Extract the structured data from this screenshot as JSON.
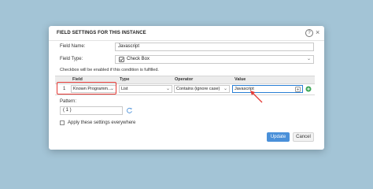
{
  "dialog": {
    "title": "FIELD SETTINGS FOR THIS INSTANCE",
    "help_icon": "?",
    "close_icon": "×"
  },
  "form": {
    "field_name_label": "Field Name:",
    "field_name_value": "Javascript",
    "field_type_label": "Field Type:",
    "field_type_value": "Check Box",
    "field_type_icon": "checkbox-icon"
  },
  "condition": {
    "heading": "Checkbox will be enabled if this condition is fulfilled.",
    "columns": [
      "Field",
      "Type",
      "Operator",
      "Value"
    ],
    "row": {
      "index": "1",
      "field": "Known Programm...",
      "type": "List",
      "operator": "Contains (ignore case)",
      "value": "Javascript"
    }
  },
  "pattern": {
    "label": "Pattern:",
    "value": "( 1 )"
  },
  "apply_everywhere": {
    "label": "Apply these settings everywhere",
    "checked": false
  },
  "buttons": {
    "update": "Update",
    "cancel": "Cancel"
  },
  "colors": {
    "accent": "#4a90d9",
    "highlight_red": "#e53935",
    "add_green": "#3aa655"
  }
}
